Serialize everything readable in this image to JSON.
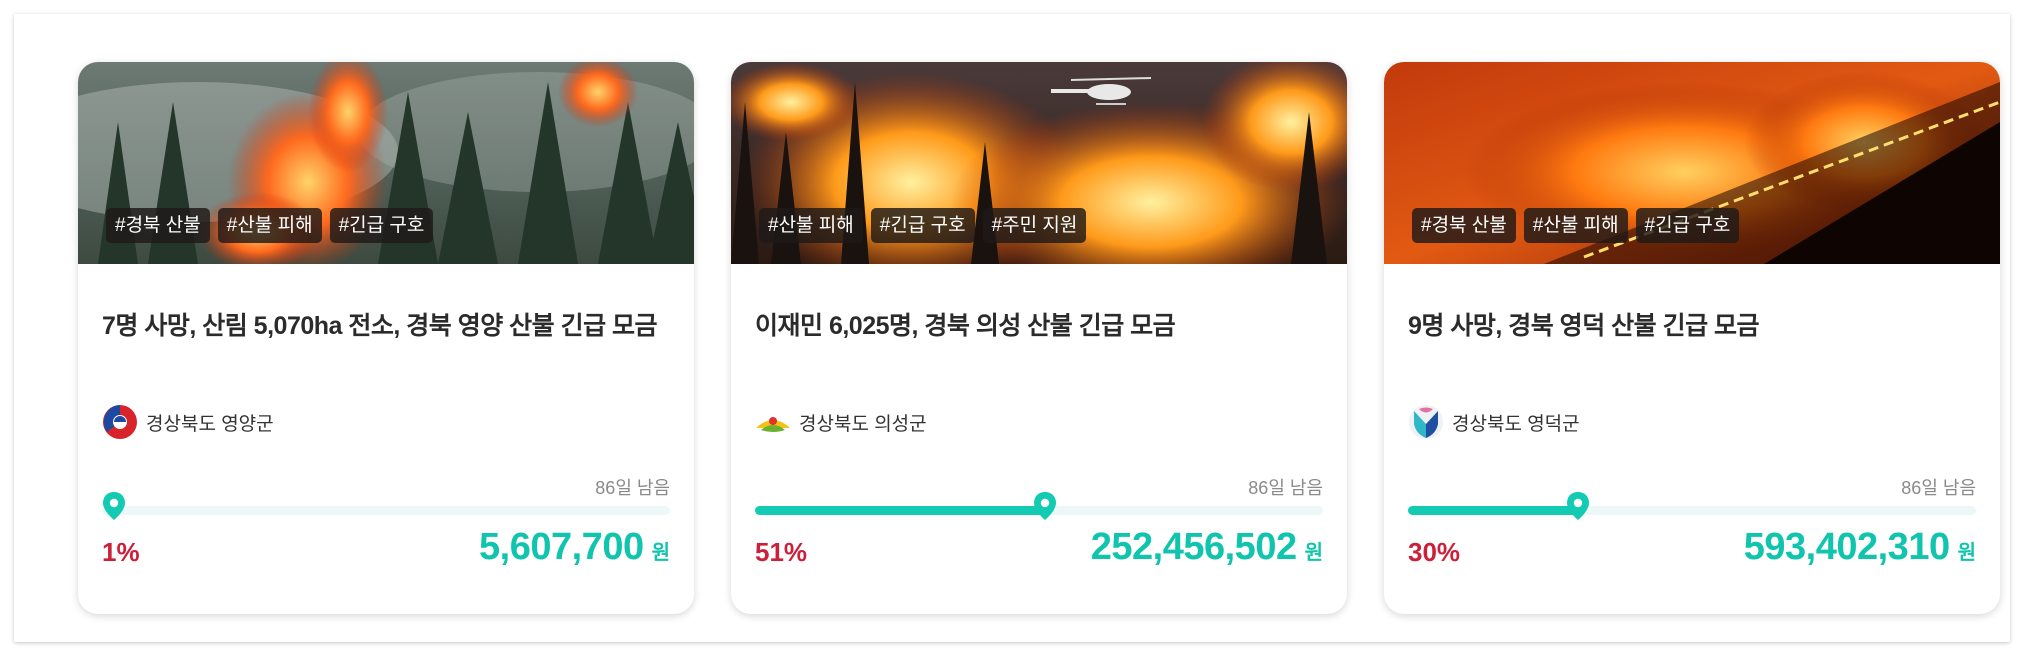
{
  "cards": [
    {
      "tags": [
        "#경북 산불",
        "#산불 피해",
        "#긴급 구호"
      ],
      "title": "7명 사망, 산림 5,070ha 전소, 경북 영양 산불 긴급 모금",
      "org": "경상북도 영양군",
      "days_left": "86일 남음",
      "progress": 0.01,
      "percent_text": "1%",
      "amount": "5,607,700",
      "unit": "원",
      "image": "smoky-forest-fire"
    },
    {
      "tags": [
        "#산불 피해",
        "#긴급 구호",
        "#주민 지원"
      ],
      "title": "이재민 6,025명, 경북 의성 산불 긴급 모금",
      "org": "경상북도 의성군",
      "days_left": "86일 남음",
      "progress": 0.51,
      "percent_text": "51%",
      "amount": "252,456,502",
      "unit": "원",
      "image": "forest-fire-with-helicopter"
    },
    {
      "tags": [
        "#경북 산불",
        "#산불 피해",
        "#긴급 구호"
      ],
      "title": "9명 사망, 경북 영덕 산불 긴급 모금",
      "org": "경상북도 영덕군",
      "days_left": "86일 남음",
      "progress": 0.3,
      "percent_text": "30%",
      "amount": "593,402,310",
      "unit": "원",
      "image": "night-hillside-fire-line"
    }
  ],
  "colors": {
    "accent": "#13cbb2",
    "amount": "#10c4ad",
    "percent": "#cc1f3a",
    "track": "#ecf8f7"
  },
  "icons": {
    "progress_marker": "map-pin-icon",
    "org_logos": [
      "yeongyang-logo",
      "uiseong-logo",
      "yeongdeok-logo"
    ]
  }
}
